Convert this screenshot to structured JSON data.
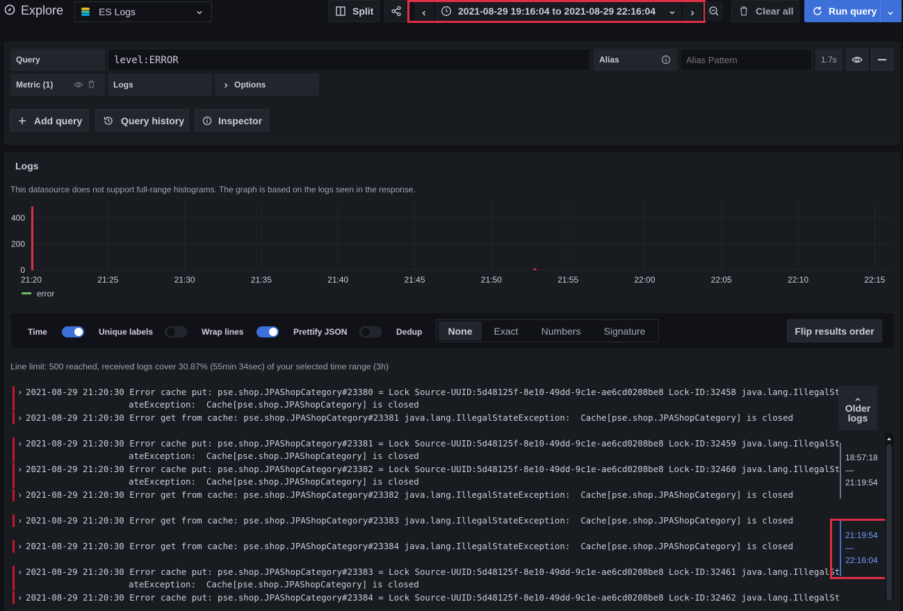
{
  "topbar": {
    "title": "Explore",
    "datasource": "ES Logs",
    "split_label": "Split",
    "time_range": "2021-08-29 19:16:04 to 2021-08-29 22:16:04",
    "clear_all_label": "Clear all",
    "run_query_label": "Run query"
  },
  "query": {
    "query_label": "Query",
    "query_value": "level:ERROR",
    "alias_label": "Alias",
    "alias_placeholder": "Alias Pattern",
    "duration": "1.7s",
    "metric_label": "Metric (1)",
    "logs_label": "Logs",
    "options_label": "Options"
  },
  "actions": {
    "add_query": "Add query",
    "query_history": "Query history",
    "inspector": "Inspector"
  },
  "logs": {
    "title": "Logs",
    "notice": "This datasource does not support full-range histograms. The graph is based on the logs seen in the response.",
    "legend_series": "error",
    "line_limit": "Line limit: 500 reached, received logs cover 30.87% (55min 34sec) of your selected time range (3h)",
    "flip_label": "Flip results order",
    "older_logs_label": "Older logs",
    "options": {
      "time": "Time",
      "unique_labels": "Unique labels",
      "wrap_lines": "Wrap lines",
      "prettify_json": "Prettify JSON",
      "dedup": "Dedup"
    },
    "dedup_tabs": [
      "None",
      "Exact",
      "Numbers",
      "Signature"
    ],
    "pages": [
      {
        "from": "18:57:18",
        "sep": "—",
        "to": "21:19:54"
      },
      {
        "from": "21:19:54",
        "sep": "—",
        "to": "22:16:04"
      }
    ],
    "rows": [
      {
        "line1": "2021-08-29 21:20:30 Error cache put: pse.shop.JPAShopCategory#23380 = Lock Source-UUID:5d48125f-8e10-49dd-9c1e-ae6cd0208be8 Lock-ID:32458 java.lang.IllegalSt",
        "line2": "ateException:  Cache[pse.shop.JPAShopCategory] is closed"
      },
      {
        "line1": "2021-08-29 21:20:30 Error get from cache: pse.shop.JPAShopCategory#23381 java.lang.IllegalStateException:  Cache[pse.shop.JPAShopCategory] is closed",
        "line2": ""
      },
      {
        "line1": "2021-08-29 21:20:30 Error cache put: pse.shop.JPAShopCategory#23381 = Lock Source-UUID:5d48125f-8e10-49dd-9c1e-ae6cd0208be8 Lock-ID:32459 java.lang.IllegalSt",
        "line2": "ateException:  Cache[pse.shop.JPAShopCategory] is closed"
      },
      {
        "line1": "2021-08-29 21:20:30 Error cache put: pse.shop.JPAShopCategory#23382 = Lock Source-UUID:5d48125f-8e10-49dd-9c1e-ae6cd0208be8 Lock-ID:32460 java.lang.IllegalSt",
        "line2": "ateException:  Cache[pse.shop.JPAShopCategory] is closed"
      },
      {
        "line1": "2021-08-29 21:20:30 Error get from cache: pse.shop.JPAShopCategory#23382 java.lang.IllegalStateException:  Cache[pse.shop.JPAShopCategory] is closed",
        "line2": ""
      },
      {
        "line1": "2021-08-29 21:20:30 Error get from cache: pse.shop.JPAShopCategory#23383 java.lang.IllegalStateException:  Cache[pse.shop.JPAShopCategory] is closed",
        "line2": ""
      },
      {
        "line1": "2021-08-29 21:20:30 Error get from cache: pse.shop.JPAShopCategory#23384 java.lang.IllegalStateException:  Cache[pse.shop.JPAShopCategory] is closed",
        "line2": ""
      },
      {
        "line1": "2021-08-29 21:20:30 Error cache put: pse.shop.JPAShopCategory#23383 = Lock Source-UUID:5d48125f-8e10-49dd-9c1e-ae6cd0208be8 Lock-ID:32461 java.lang.IllegalSt",
        "line2": "ateException:  Cache[pse.shop.JPAShopCategory] is closed"
      },
      {
        "line1": "2021-08-29 21:20:30 Error cache put: pse.shop.JPAShopCategory#23384 = Lock Source-UUID:5d48125f-8e10-49dd-9c1e-ae6cd0208be8 Lock-ID:32462 java.lang.IllegalSt",
        "line2": ""
      }
    ]
  },
  "chart_data": {
    "type": "bar",
    "x_ticks": [
      "21:20",
      "21:25",
      "21:30",
      "21:35",
      "21:40",
      "21:45",
      "21:50",
      "21:55",
      "22:00",
      "22:05",
      "22:10",
      "22:15"
    ],
    "y_ticks": [
      "0",
      "200",
      "400"
    ],
    "ylim": [
      0,
      500
    ],
    "series": [
      {
        "name": "error",
        "points": [
          {
            "x": "21:20",
            "y": 487
          },
          {
            "x": "21:52:45",
            "y": 13
          }
        ]
      }
    ]
  },
  "colors": {
    "accent": "#3d71d9",
    "error": "#c4162a",
    "legend": "#73bf69",
    "highlight_box": "#e02f44"
  }
}
